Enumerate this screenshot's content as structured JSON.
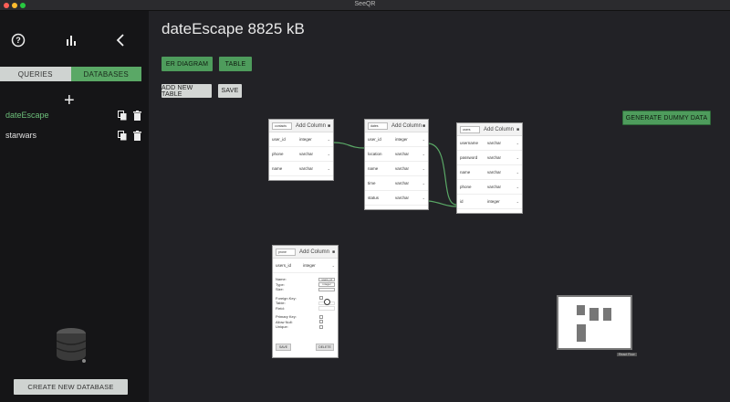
{
  "window": {
    "title": "SeeQR"
  },
  "sidebar": {
    "toggle": {
      "queries": "QUERIES",
      "databases": "DATABASES"
    },
    "databases": [
      {
        "name": "dateEscape",
        "active": true
      },
      {
        "name": "starwars",
        "active": false
      }
    ],
    "create_button": "CREATE NEW DATABASE"
  },
  "main": {
    "title": "dateEscape 8825 kB",
    "views": {
      "er": "ER DIAGRAM",
      "table": "TABLE"
    },
    "actions": {
      "add_table": "ADD NEW TABLE",
      "save": "SAVE"
    },
    "generate": "GENERATE DUMMY DATA"
  },
  "tables": [
    {
      "name": "contacts",
      "add_label": "Add Column",
      "columns": [
        {
          "name": "user_id",
          "type": "integer"
        },
        {
          "name": "phone",
          "type": "varchar"
        },
        {
          "name": "name",
          "type": "varchar"
        }
      ]
    },
    {
      "name": "dates",
      "add_label": "Add Column",
      "columns": [
        {
          "name": "user_id",
          "type": "integer"
        },
        {
          "name": "location",
          "type": "varchar"
        },
        {
          "name": "name",
          "type": "varchar"
        },
        {
          "name": "time",
          "type": "varchar"
        },
        {
          "name": "status",
          "type": "varchar"
        }
      ]
    },
    {
      "name": "users",
      "add_label": "Add Column",
      "columns": [
        {
          "name": "username",
          "type": "varchar"
        },
        {
          "name": "password",
          "type": "varchar"
        },
        {
          "name": "name",
          "type": "varchar"
        },
        {
          "name": "phone",
          "type": "varchar"
        },
        {
          "name": "id",
          "type": "integer"
        }
      ]
    },
    {
      "name": "prone",
      "add_label": "Add Column",
      "columns": [
        {
          "name": "users_id",
          "type": "integer"
        }
      ],
      "details": {
        "name_label": "Name:",
        "name_value": "users_id",
        "type_label": "Type:",
        "type_value": "integer",
        "size_label": "Size:",
        "fk_label": "Foreign Key:",
        "table_label": "Table:",
        "field_label": "Field:",
        "pk_label": "Primary Key:",
        "null_label": "Allow Null:",
        "unique_label": "Unique:",
        "save": "SAVE",
        "delete": "DELETE"
      }
    }
  ],
  "minimap": {
    "label": "React Flow"
  },
  "colors": {
    "accent": "#4e9c5c",
    "background": "#222226",
    "sidebar": "#151517",
    "edge": "#5aa866"
  },
  "icons": [
    "help-icon",
    "bar-chart-icon",
    "chevron-left-icon",
    "plus-icon",
    "copy-icon",
    "trash-icon",
    "database-icon"
  ]
}
